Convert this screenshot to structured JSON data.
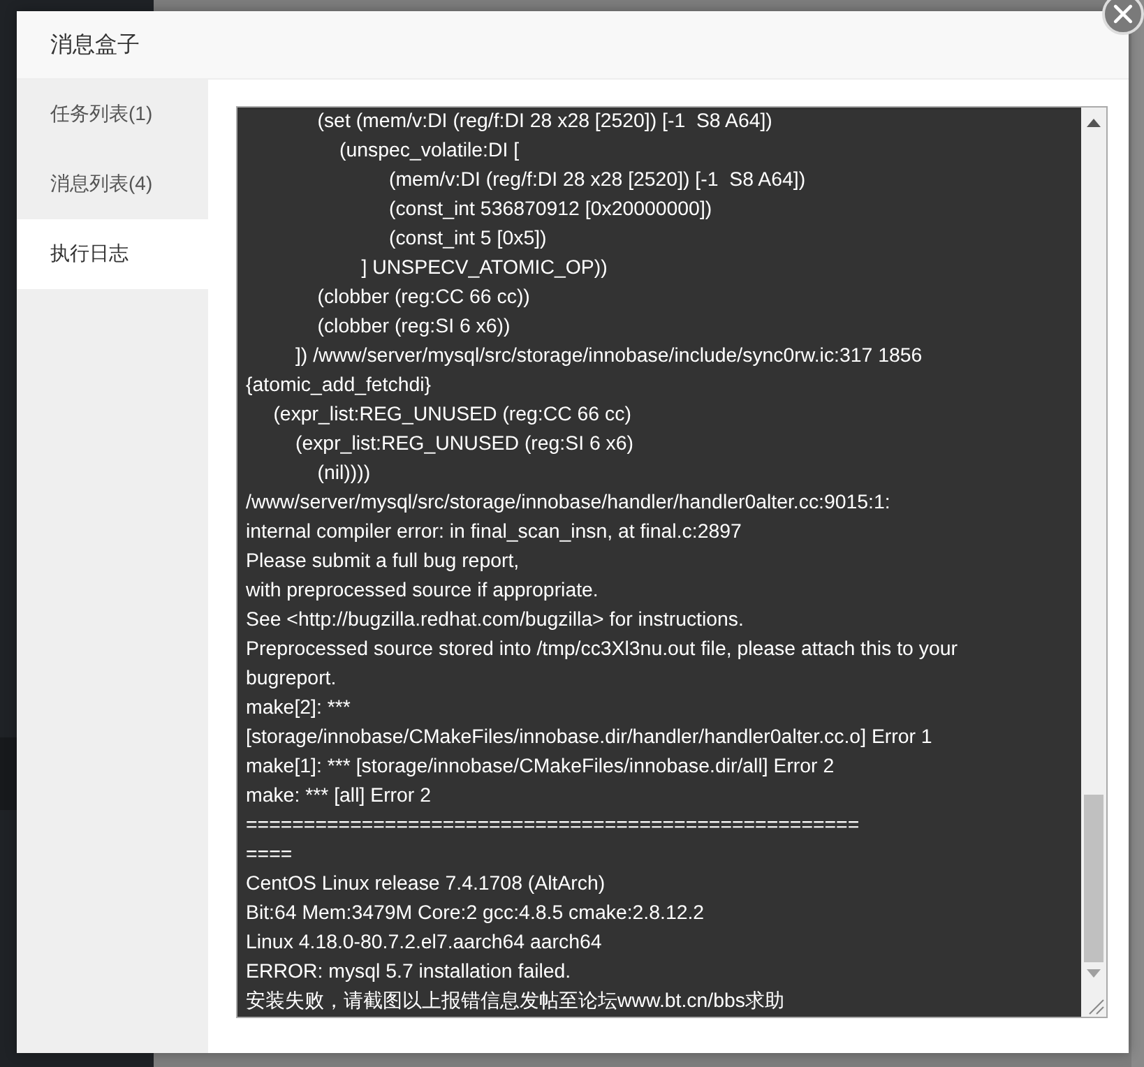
{
  "dialog": {
    "title": "消息盒子",
    "tabs": [
      {
        "label": "任务列表(1)",
        "selected": false
      },
      {
        "label": "消息列表(4)",
        "selected": false
      },
      {
        "label": "执行日志",
        "selected": true
      }
    ],
    "log_lines": [
      "             (set (mem/v:DI (reg/f:DI 28 x28 [2520]) [-1  S8 A64])",
      "                 (unspec_volatile:DI [",
      "                          (mem/v:DI (reg/f:DI 28 x28 [2520]) [-1  S8 A64])",
      "                          (const_int 536870912 [0x20000000])",
      "                          (const_int 5 [0x5])",
      "                     ] UNSPECV_ATOMIC_OP))",
      "             (clobber (reg:CC 66 cc))",
      "             (clobber (reg:SI 6 x6))",
      "         ]) /www/server/mysql/src/storage/innobase/include/sync0rw.ic:317 1856",
      "{atomic_add_fetchdi}",
      "     (expr_list:REG_UNUSED (reg:CC 66 cc)",
      "         (expr_list:REG_UNUSED (reg:SI 6 x6)",
      "             (nil))))",
      "/www/server/mysql/src/storage/innobase/handler/handler0alter.cc:9015:1:",
      "internal compiler error: in final_scan_insn, at final.c:2897",
      "Please submit a full bug report,",
      "with preprocessed source if appropriate.",
      "See <http://bugzilla.redhat.com/bugzilla> for instructions.",
      "Preprocessed source stored into /tmp/cc3Xl3nu.out file, please attach this to your",
      "bugreport.",
      "make[2]: ***",
      "[storage/innobase/CMakeFiles/innobase.dir/handler/handler0alter.cc.o] Error 1",
      "make[1]: *** [storage/innobase/CMakeFiles/innobase.dir/all] Error 2",
      "make: *** [all] Error 2",
      "=====================================================",
      "====",
      "CentOS Linux release 7.4.1708 (AltArch)",
      "Bit:64 Mem:3479M Core:2 gcc:4.8.5 cmake:2.8.12.2",
      "Linux 4.18.0-80.7.2.el7.aarch64 aarch64",
      "ERROR: mysql 5.7 installation failed.",
      "安装失败，请截图以上报错信息发帖至论坛www.bt.cn/bbs求助"
    ]
  }
}
